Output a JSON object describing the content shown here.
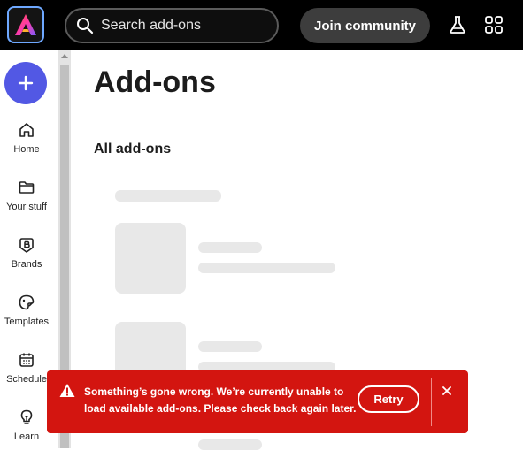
{
  "header": {
    "search_placeholder": "Search add-ons",
    "join_label": "Join community"
  },
  "sidebar": {
    "items": [
      {
        "label": "Home",
        "icon": "home-icon"
      },
      {
        "label": "Your stuff",
        "icon": "folder-icon"
      },
      {
        "label": "Brands",
        "icon": "brand-icon"
      },
      {
        "label": "Templates",
        "icon": "templates-icon"
      },
      {
        "label": "Schedule",
        "icon": "calendar-icon"
      },
      {
        "label": "Learn",
        "icon": "lightbulb-icon"
      }
    ]
  },
  "main": {
    "title": "Add-ons",
    "section_title": "All add-ons"
  },
  "toast": {
    "message": "Something’s gone wrong. We’re currently unable to load available add-ons. Please check back again later.",
    "retry_label": "Retry"
  },
  "colors": {
    "accent": "#5258e4",
    "error": "#d31510",
    "topbar": "#000000"
  }
}
